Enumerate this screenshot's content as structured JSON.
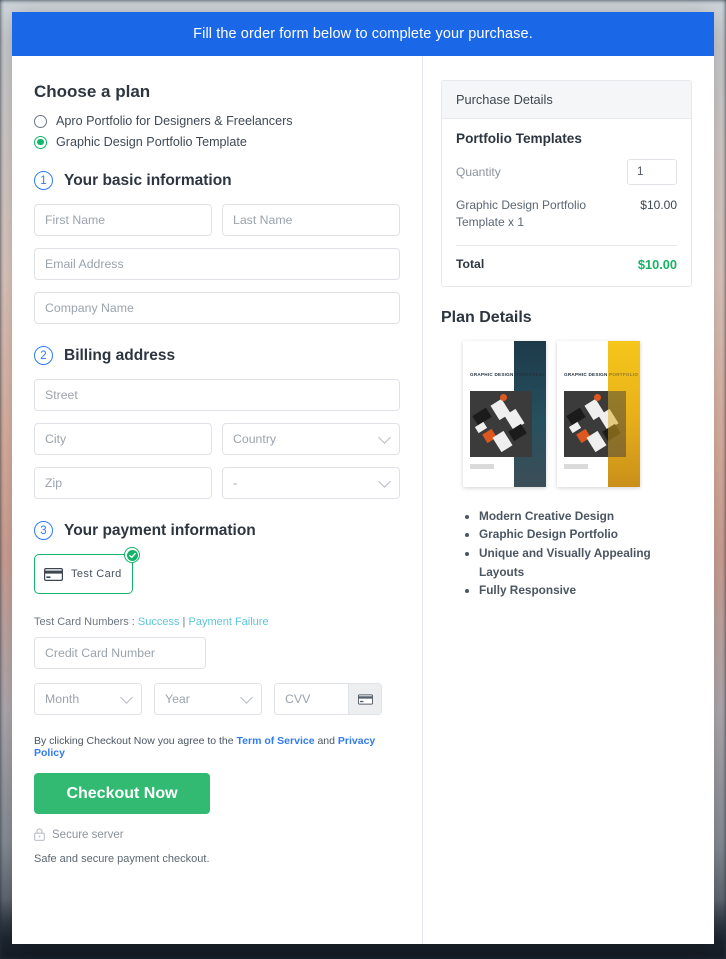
{
  "banner": {
    "text": "Fill the order form below to complete your purchase."
  },
  "plans": {
    "heading": "Choose a plan",
    "options": [
      {
        "label": "Apro Portfolio for Designers & Freelancers",
        "selected": false
      },
      {
        "label": "Graphic Design Portfolio Template",
        "selected": true
      }
    ]
  },
  "steps": {
    "basic": {
      "number": "1",
      "title": "Your basic information",
      "first_name_placeholder": "First Name",
      "last_name_placeholder": "Last Name",
      "email_placeholder": "Email Address",
      "company_placeholder": "Company Name"
    },
    "billing": {
      "number": "2",
      "title": "Billing address",
      "street_placeholder": "Street",
      "city_placeholder": "City",
      "country_placeholder": "Country",
      "zip_placeholder": "Zip",
      "state_placeholder": "-"
    },
    "payment": {
      "number": "3",
      "title": "Your payment information",
      "method_label": "Test Card",
      "test_card_prefix": "Test Card Numbers : ",
      "test_card_success": "Success",
      "test_card_separator": " | ",
      "test_card_failure": "Payment Failure",
      "card_number_placeholder": "Credit Card Number",
      "month_placeholder": "Month",
      "year_placeholder": "Year",
      "cvv_placeholder": "CVV"
    }
  },
  "legal": {
    "prefix": "By clicking Checkout Now you agree to the ",
    "terms": "Term of Service",
    "conjunction": " and ",
    "privacy": "Privacy Policy"
  },
  "actions": {
    "checkout_label": "Checkout Now",
    "secure_label": "Secure server",
    "safe_note": "Safe and secure payment checkout."
  },
  "purchase": {
    "header": "Purchase Details",
    "product_title": "Portfolio Templates",
    "quantity_label": "Quantity",
    "quantity_value": "1",
    "line_item_name": "Graphic Design Portfolio Template x 1",
    "line_item_amount": "$10.00",
    "total_label": "Total",
    "total_amount": "$10.00"
  },
  "plan_details": {
    "heading": "Plan Details",
    "preview_titles": [
      "GRAPHIC DESIGN PORTFOLIO",
      "GRAPHIC DESIGN PORTFOLIO"
    ],
    "features": [
      "Modern Creative Design",
      "Graphic Design Portfolio",
      "Unique and Visually Appealing Layouts",
      "Fully Responsive"
    ]
  },
  "colors": {
    "banner_blue": "#1a68e8",
    "accent_green": "#32b972",
    "total_green": "#16b364",
    "step_blue": "#2f7bf0",
    "link_cyan": "#5bc6dd"
  }
}
